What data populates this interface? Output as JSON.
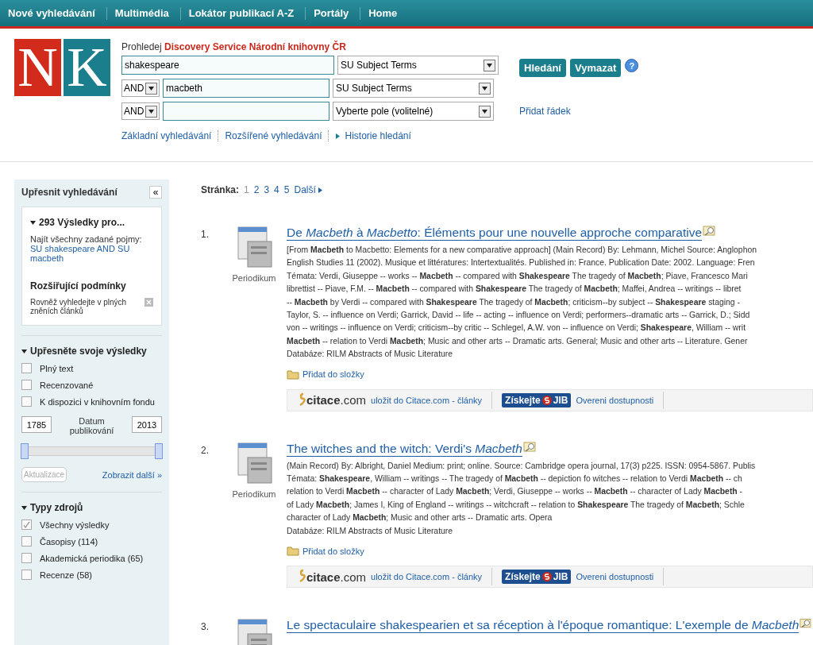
{
  "top_nav": [
    {
      "label": "Nové vyhledávání"
    },
    {
      "label": "Multimédia"
    },
    {
      "label": "Lokátor publikací A-Z"
    },
    {
      "label": "Portály"
    },
    {
      "label": "Home"
    }
  ],
  "logo": {
    "letters": [
      "N",
      "K"
    ]
  },
  "search": {
    "prefix": "Prohledej",
    "service": "Discovery Service Národní knihovny ČR",
    "rows": [
      {
        "operator": null,
        "value": "shakespeare",
        "field": "SU Subject Terms"
      },
      {
        "operator": "AND",
        "value": "macbeth",
        "field": "SU Subject Terms"
      },
      {
        "operator": "AND",
        "value": "",
        "field": "Vyberte pole (volitelné)"
      }
    ],
    "buttons": [
      "Hledání",
      "Vymazat"
    ],
    "help": "?",
    "add_row": "Přidat řádek",
    "links": [
      "Základní vyhledávání",
      "Rozšířené vyhledávání",
      "Historie hledání"
    ]
  },
  "sidebar": {
    "title": "Upřesnit vyhledávání",
    "collapse": "«",
    "summary": {
      "heading": "293 Výsledky pro...",
      "find_all": "Najít všechny zadané pojmy:",
      "query": "SU shakespeare AND SU macbeth",
      "expanders_title": "Rozšiřující podmínky",
      "expander": "Rovněž vyhledejte v plných zněních článků"
    },
    "refine": {
      "heading": "Upřesněte svoje výsledky",
      "expanded": true,
      "options": [
        {
          "label": "Plný text",
          "checked": false
        },
        {
          "label": "Recenzované",
          "checked": false
        },
        {
          "label": "K dispozici v knihovním fondu",
          "checked": false
        }
      ],
      "date_from": "1785",
      "date_label": "Datum publikování",
      "date_to": "2013",
      "slider": {
        "level": 1
      },
      "update": {
        "label": "Aktualizace",
        "disabled": true
      },
      "more": "Zobrazit další »"
    },
    "source_types": {
      "heading": "Typy zdrojů",
      "expanded": true,
      "options": [
        {
          "label": "Všechny výsledky",
          "checked": true
        },
        {
          "label": "Časopisy (114)",
          "checked": false
        },
        {
          "label": "Akademická periodika (65)",
          "checked": false
        },
        {
          "label": "Recenze (58)",
          "checked": false
        }
      ]
    }
  },
  "pagination": {
    "label": "Stránka:",
    "pages": [
      {
        "label": "1",
        "selected": true
      },
      {
        "label": "2",
        "selected": false
      },
      {
        "label": "3",
        "selected": false
      },
      {
        "label": "4",
        "selected": false
      },
      {
        "label": "5",
        "selected": false
      }
    ],
    "next": "Další"
  },
  "results": [
    {
      "number": "1.",
      "type": "Periodikum",
      "title": "De *Macbeth* à *Macbetto*: Éléments pour une nouvelle approche comparative",
      "lines": [
        "[From **Macbeth** to Macbetto: Elements for a new comparative approach] (Main Record) By: Lehmann, Michel Source: Anglophon",
        "English Studies 11 (2002). Musique et littératures: Intertextualités. Published in: France. Publication Date: 2002. Language: Fren",
        "Témata: Verdi, Giuseppe -- works -- **Macbeth** -- compared with **Shakespeare** The tragedy of **Macbeth**; Piave, Francesco Mari",
        "librettist -- Piave, F.M. -- **Macbeth** -- compared with **Shakespeare** The tragedy of **Macbeth**; Maffei, Andrea -- writings -- libret",
        "-- **Macbeth** by Verdi -- compared with **Shakespeare** The tragedy of **Macbeth**; criticism--by subject -- **Shakespeare** staging -",
        "Taylor, S. -- influence on Verdi; Garrick, David -- life -- acting -- influence on Verdi; performers--dramatic arts -- Garrick, D.; Sidd",
        "von -- writings -- influence on Verdi; criticism--by critic -- Schlegel, A.W. von -- influence on Verdi; **Shakespeare**, William -- writ",
        "**Macbeth** -- relation to Verdi **Macbeth**; Music and other arts -- Dramatic arts. General; Music and other arts -- Literature. Gener",
        "Databáze: RILM Abstracts of Music Literature"
      ],
      "add_folder": "Přidat do složky",
      "citace_brand": "citace",
      "citace_domain": ".com",
      "citace_link": "uložit do Citace.com - články",
      "jib_label": "Získejte",
      "jib_brand": "JIB",
      "availability": "Overeni dostupnosti"
    },
    {
      "number": "2.",
      "type": "Periodikum",
      "title": "The witches and the witch: Verdi's *Macbeth*",
      "lines": [
        "(Main Record) By: Albright, Daniel Medium: print; online. Source: Cambridge opera journal, 17(3) p225. ISSN: 0954-5867. Publis",
        "Témata: **Shakespeare**, William -- writings -- The tragedy of **Macbeth** -- depiction fo witches -- relation to Verdi **Macbeth** -- ch",
        "relation to Verdi **Macbeth** -- character of Lady **Macbeth**; Verdi, Giuseppe -- works -- **Macbeth** -- character of Lady **Macbeth** -",
        "of Lady **Macbeth**; James I, King of England -- writings -- witchcraft -- relation to **Shakespeare** The tragedy of **Macbeth**; Schle",
        "character of Lady **Macbeth**; Music and other arts -- Dramatic arts. Opera",
        "Databáze: RILM Abstracts of Music Literature"
      ],
      "add_folder": "Přidat do složky",
      "citace_brand": "citace",
      "citace_domain": ".com",
      "citace_link": "uložit do Citace.com - články",
      "jib_label": "Získejte",
      "jib_brand": "JIB",
      "availability": "Overeni dostupnosti"
    },
    {
      "number": "3.",
      "title": "Le spectaculaire shakespearien et sa réception à l'époque romantique: L'exemple de *Macbeth*"
    }
  ]
}
